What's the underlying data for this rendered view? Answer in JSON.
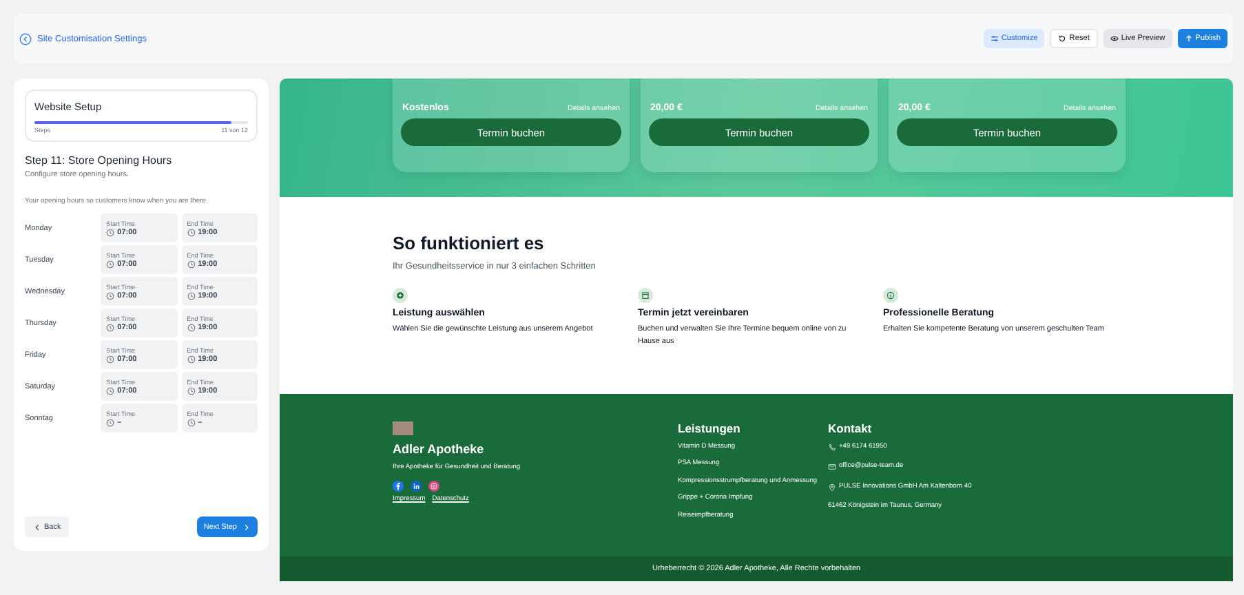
{
  "header": {
    "title": "Site Customisation Settings",
    "buttons": [
      {
        "label": "Customize",
        "kind": "toggle",
        "selected": true
      },
      {
        "label": "Reset",
        "kind": "reset",
        "selected": false
      },
      {
        "label": "Live Preview",
        "kind": "preview",
        "selected": false
      },
      {
        "label": "Publish",
        "kind": "primary",
        "selected": false
      }
    ]
  },
  "setup": {
    "title": "Website Setup",
    "level": 0.92,
    "steps_label": "Steps",
    "count": "11 von 12"
  },
  "step": {
    "title": "Step 11: Store Opening Hours",
    "subtitle": "Configure store opening hours.",
    "intro": "Your opening hours so customers know when you are there.",
    "days": [
      {
        "day": "Monday",
        "start_label": "Start Time",
        "start": "07:00",
        "end_label": "End Time",
        "end": "19:00"
      },
      {
        "day": "Tuesday",
        "start_label": "Start Time",
        "start": "07:00",
        "end_label": "End Time",
        "end": "19:00"
      },
      {
        "day": "Wednesday",
        "start_label": "Start Time",
        "start": "07:00",
        "end_label": "End Time",
        "end": "19:00"
      },
      {
        "day": "Thursday",
        "start_label": "Start Time",
        "start": "07:00",
        "end_label": "End Time",
        "end": "19:00"
      },
      {
        "day": "Friday",
        "start_label": "Start Time",
        "start": "07:00",
        "end_label": "End Time",
        "end": "19:00"
      },
      {
        "day": "Saturday",
        "start_label": "Start Time",
        "start": "07:00",
        "end_label": "End Time",
        "end": "19:00"
      },
      {
        "day": "Sonntag",
        "start_label": "Start Time",
        "start": "–",
        "end_label": "End Time",
        "end": "–"
      }
    ],
    "back": "Back",
    "next": "Next Step"
  },
  "preview": {
    "cards": [
      {
        "price": "Kostenlos",
        "details": "Details ansehen",
        "button": "Termin buchen"
      },
      {
        "price": "20,00 €",
        "details": "Details ansehen",
        "button": "Termin buchen"
      },
      {
        "price": "20,00 €",
        "details": "Details ansehen",
        "button": "Termin buchen"
      }
    ],
    "how": {
      "title": "So funktioniert es",
      "subtitle": "Ihr Gesundheitsservice in nur 3 einfachen Schritten",
      "steps": [
        {
          "kind": "plus",
          "title": "Leistung auswählen",
          "text": "Wählen Sie die gewünschte Leistung aus unserem Angebot"
        },
        {
          "kind": "calendar",
          "title": "Termin jetzt vereinbaren",
          "text": "Buchen und verwalten Sie Ihre Termine bequem online von zu Hause aus"
        },
        {
          "kind": "info",
          "title": "Professionelle Beratung",
          "text": "Erhalten Sie kompetente Beratung von unserem geschulten Team"
        }
      ]
    },
    "footer": {
      "name": "Adler Apotheke",
      "tagline": "Ihre Apotheke für Gesundheit und Beratung",
      "links": [
        "Impressum",
        "Datenschutz"
      ],
      "services_title": "Leistungen",
      "services": [
        "Vitamin D Messung",
        "PSA Messung",
        "Kompressionsstrumpfberatung und Anmessung",
        "Grippe + Corona Impfung",
        "Reiseimpfberatung"
      ],
      "contact_title": "Kontakt",
      "contact": [
        {
          "kind": "phone",
          "text": "+49 6174 61950"
        },
        {
          "kind": "mail",
          "text": "office@pulse-team.de"
        },
        {
          "kind": "pin",
          "text": "PULSE Innovations GmbH Am Kaltenborn 40"
        },
        {
          "kind": "none",
          "text": "61462 Königstein im Taunus, Germany"
        }
      ],
      "copyright": "Urheberrecht © 2026 Adler Apotheke, Alle Rechte vorbehalten"
    }
  }
}
